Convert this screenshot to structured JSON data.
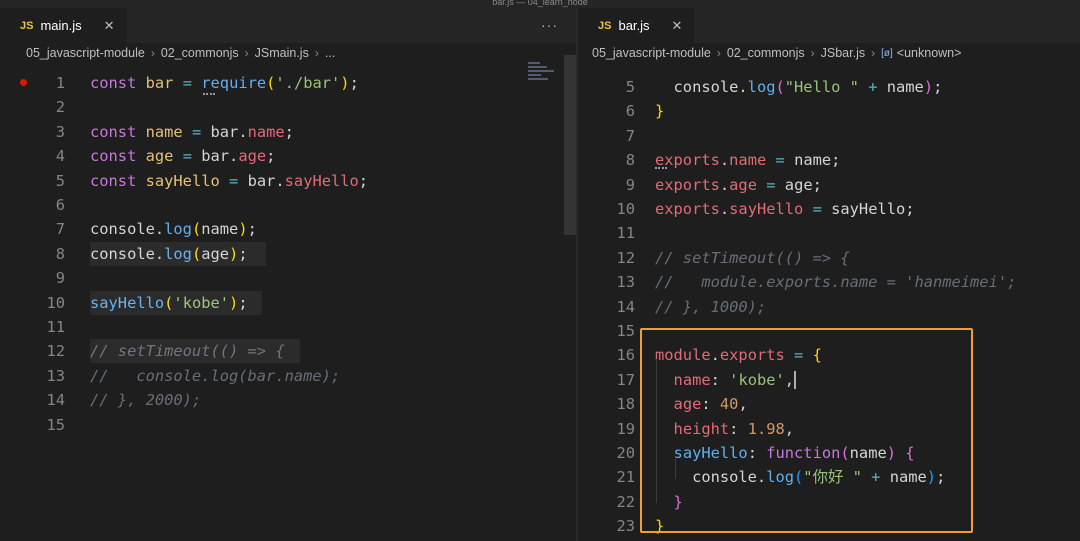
{
  "window_title": "bar.js — 04_learn_node",
  "colors": {
    "highlight_box": "#f0a030",
    "js_badge": "#e8c34a",
    "breakpoint": "#e51400"
  },
  "left": {
    "tab": {
      "badge": "JS",
      "name": "main.js",
      "close_icon": "close-icon"
    },
    "actions": "···",
    "breadcrumb": [
      "05_javascript-module",
      "02_commonjs",
      "main.js",
      "..."
    ],
    "lines": [
      {
        "n": "1",
        "tokens": [
          [
            "k",
            "const "
          ],
          [
            "v",
            "bar"
          ],
          [
            "t",
            " "
          ],
          [
            "op",
            "="
          ],
          [
            "t",
            " "
          ],
          [
            "f",
            "require"
          ],
          [
            "b1",
            "("
          ],
          [
            "s",
            "'./bar'"
          ],
          [
            "b1",
            ")"
          ],
          [
            "t",
            ";"
          ]
        ]
      },
      {
        "n": "2",
        "tokens": []
      },
      {
        "n": "3",
        "tokens": [
          [
            "k",
            "const "
          ],
          [
            "v",
            "name"
          ],
          [
            "t",
            " "
          ],
          [
            "op",
            "="
          ],
          [
            "t",
            " bar."
          ],
          [
            "vr",
            "name"
          ],
          [
            "t",
            ";"
          ]
        ]
      },
      {
        "n": "4",
        "tokens": [
          [
            "k",
            "const "
          ],
          [
            "v",
            "age"
          ],
          [
            "t",
            " "
          ],
          [
            "op",
            "="
          ],
          [
            "t",
            " bar."
          ],
          [
            "vr",
            "age"
          ],
          [
            "t",
            ";"
          ]
        ]
      },
      {
        "n": "5",
        "tokens": [
          [
            "k",
            "const "
          ],
          [
            "v",
            "sayHello"
          ],
          [
            "t",
            " "
          ],
          [
            "op",
            "="
          ],
          [
            "t",
            " bar."
          ],
          [
            "vr",
            "sayHello"
          ],
          [
            "t",
            ";"
          ]
        ]
      },
      {
        "n": "6",
        "tokens": []
      },
      {
        "n": "7",
        "tokens": [
          [
            "t",
            "console."
          ],
          [
            "f",
            "log"
          ],
          [
            "b1",
            "("
          ],
          [
            "t",
            "name"
          ],
          [
            "b1",
            ")"
          ],
          [
            "t",
            ";"
          ]
        ]
      },
      {
        "n": "8",
        "tokens": [
          [
            "t",
            "console."
          ],
          [
            "f",
            "log"
          ],
          [
            "b1",
            "("
          ],
          [
            "t",
            "age"
          ],
          [
            "b1",
            ")"
          ],
          [
            "t",
            ";"
          ]
        ]
      },
      {
        "n": "9",
        "tokens": []
      },
      {
        "n": "10",
        "tokens": [
          [
            "f",
            "sayHello"
          ],
          [
            "b1",
            "("
          ],
          [
            "s",
            "'kobe'"
          ],
          [
            "b1",
            ")"
          ],
          [
            "t",
            ";"
          ]
        ]
      },
      {
        "n": "11",
        "tokens": []
      },
      {
        "n": "12",
        "tokens": [
          [
            "c",
            "// setTimeout(() => {"
          ]
        ]
      },
      {
        "n": "13",
        "tokens": [
          [
            "c",
            "//   console.log(bar.name);"
          ]
        ]
      },
      {
        "n": "14",
        "tokens": [
          [
            "c",
            "// }, 2000);"
          ]
        ]
      },
      {
        "n": "15",
        "tokens": []
      }
    ]
  },
  "right": {
    "tab": {
      "badge": "JS",
      "name": "bar.js",
      "close_icon": "close-icon"
    },
    "breadcrumb": [
      "05_javascript-module",
      "02_commonjs",
      "bar.js",
      "<unknown>"
    ],
    "breadcrumb_symbol": "[ø]",
    "lines": [
      {
        "n": "5",
        "tokens": [
          [
            "t",
            "  console."
          ],
          [
            "f",
            "log"
          ],
          [
            "b2",
            "("
          ],
          [
            "s",
            "\"Hello \""
          ],
          [
            "t",
            " "
          ],
          [
            "op",
            "+"
          ],
          [
            "t",
            " name"
          ],
          [
            "b2",
            ")"
          ],
          [
            "t",
            ";"
          ]
        ]
      },
      {
        "n": "6",
        "tokens": [
          [
            "b1",
            "}"
          ]
        ]
      },
      {
        "n": "7",
        "tokens": []
      },
      {
        "n": "8",
        "tokens": [
          [
            "vr",
            "exports"
          ],
          [
            "t",
            "."
          ],
          [
            "vr",
            "name"
          ],
          [
            "t",
            " "
          ],
          [
            "op",
            "="
          ],
          [
            "t",
            " name;"
          ]
        ]
      },
      {
        "n": "9",
        "tokens": [
          [
            "vr",
            "exports"
          ],
          [
            "t",
            "."
          ],
          [
            "vr",
            "age"
          ],
          [
            "t",
            " "
          ],
          [
            "op",
            "="
          ],
          [
            "t",
            " age;"
          ]
        ]
      },
      {
        "n": "10",
        "tokens": [
          [
            "vr",
            "exports"
          ],
          [
            "t",
            "."
          ],
          [
            "vr",
            "sayHello"
          ],
          [
            "t",
            " "
          ],
          [
            "op",
            "="
          ],
          [
            "t",
            " sayHello;"
          ]
        ]
      },
      {
        "n": "11",
        "tokens": []
      },
      {
        "n": "12",
        "tokens": [
          [
            "c",
            "// setTimeout(() => {"
          ]
        ]
      },
      {
        "n": "13",
        "tokens": [
          [
            "c",
            "//   module.exports.name = 'hanmeimei';"
          ]
        ]
      },
      {
        "n": "14",
        "tokens": [
          [
            "c",
            "// }, 1000);"
          ]
        ]
      },
      {
        "n": "15",
        "tokens": []
      },
      {
        "n": "16",
        "tokens": [
          [
            "vr",
            "module"
          ],
          [
            "t",
            "."
          ],
          [
            "vr",
            "exports"
          ],
          [
            "t",
            " "
          ],
          [
            "op",
            "="
          ],
          [
            "t",
            " "
          ],
          [
            "b1",
            "{"
          ]
        ]
      },
      {
        "n": "17",
        "tokens": [
          [
            "t",
            "  "
          ],
          [
            "vr",
            "name"
          ],
          [
            "t",
            ": "
          ],
          [
            "s",
            "'kobe'"
          ],
          [
            "t",
            ","
          ],
          [
            "cursor",
            ""
          ]
        ]
      },
      {
        "n": "18",
        "tokens": [
          [
            "t",
            "  "
          ],
          [
            "vr",
            "age"
          ],
          [
            "t",
            ": "
          ],
          [
            "n",
            "40"
          ],
          [
            "t",
            ","
          ]
        ]
      },
      {
        "n": "19",
        "tokens": [
          [
            "t",
            "  "
          ],
          [
            "vr",
            "height"
          ],
          [
            "t",
            ": "
          ],
          [
            "n",
            "1.98"
          ],
          [
            "t",
            ","
          ]
        ]
      },
      {
        "n": "20",
        "tokens": [
          [
            "t",
            "  "
          ],
          [
            "f",
            "sayHello"
          ],
          [
            "t",
            ": "
          ],
          [
            "k",
            "function"
          ],
          [
            "b2",
            "("
          ],
          [
            "t",
            "name"
          ],
          [
            "b2",
            ")"
          ],
          [
            "t",
            " "
          ],
          [
            "b2",
            "{"
          ]
        ]
      },
      {
        "n": "21",
        "tokens": [
          [
            "t",
            "    console."
          ],
          [
            "f",
            "log"
          ],
          [
            "b3",
            "("
          ],
          [
            "s",
            "\"你好 \""
          ],
          [
            "t",
            " "
          ],
          [
            "op",
            "+"
          ],
          [
            "t",
            " name"
          ],
          [
            "b3",
            ")"
          ],
          [
            "t",
            ";"
          ]
        ]
      },
      {
        "n": "22",
        "tokens": [
          [
            "t",
            "  "
          ],
          [
            "b2",
            "}"
          ]
        ]
      },
      {
        "n": "23",
        "tokens": [
          [
            "b1",
            "}"
          ]
        ]
      }
    ]
  }
}
